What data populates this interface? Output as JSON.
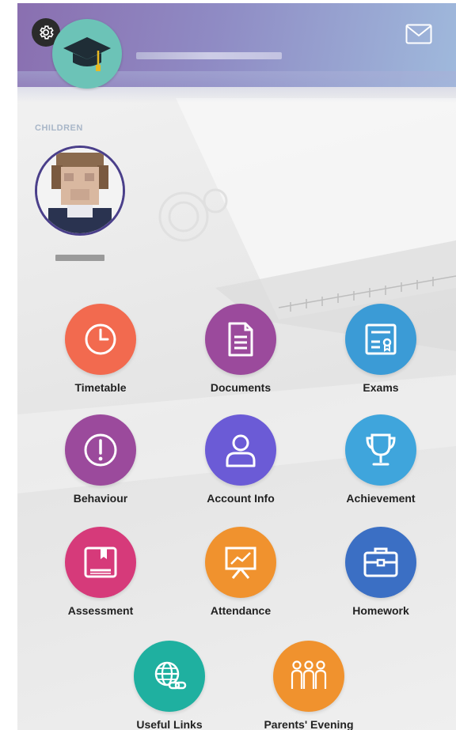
{
  "header": {
    "settings_icon": "gear-icon",
    "logo_icon": "graduation-cap-icon",
    "mail_icon": "mail-icon",
    "colors": {
      "gradient_start": "#8a6fb0",
      "gradient_end": "#9fb9dc",
      "logo_bg": "#6cc3b7"
    }
  },
  "children": {
    "section_label": "CHILDREN"
  },
  "tiles": [
    {
      "label": "Timetable",
      "icon": "clock-icon",
      "color": "#f26a4f"
    },
    {
      "label": "Documents",
      "icon": "document-icon",
      "color": "#9b4a9c"
    },
    {
      "label": "Exams",
      "icon": "certificate-icon",
      "color": "#3b9bd6"
    },
    {
      "label": "Behaviour",
      "icon": "exclamation-icon",
      "color": "#9b4a9c"
    },
    {
      "label": "Account Info",
      "icon": "user-icon",
      "color": "#6b5bd6"
    },
    {
      "label": "Achievement",
      "icon": "trophy-icon",
      "color": "#3fa5dc"
    },
    {
      "label": "Assessment",
      "icon": "book-icon",
      "color": "#d63a7a"
    },
    {
      "label": "Attendance",
      "icon": "presentation-icon",
      "color": "#f0922e"
    },
    {
      "label": "Homework",
      "icon": "briefcase-icon",
      "color": "#3b6fc4"
    },
    {
      "label": "Useful Links",
      "icon": "globe-link-icon",
      "color": "#1fb0a0"
    },
    {
      "label": "Parents' Evening",
      "icon": "people-icon",
      "color": "#f0922e"
    }
  ]
}
